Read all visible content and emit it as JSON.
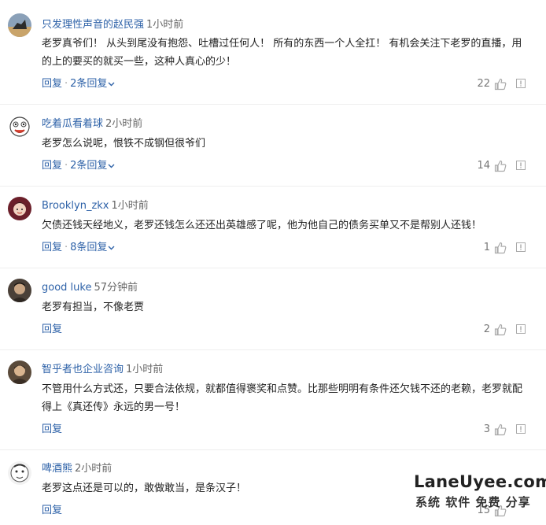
{
  "comments": [
    {
      "user": "只发理性声音的赵民强",
      "time": "1小时前",
      "text": "老罗真爷们！ 从头到尾没有抱怨、吐槽过任何人！ 所有的东西一个人全扛！ 有机会关注下老罗的直播，用的上的要买的就买一些，这种人真心的少！",
      "reply": "回复",
      "replies": "2条回复",
      "likes": "22"
    },
    {
      "user": "吃着瓜看着球",
      "time": "2小时前",
      "text": "老罗怎么说呢，恨铁不成钢但很爷们",
      "reply": "回复",
      "replies": "2条回复",
      "likes": "14"
    },
    {
      "user": "Brooklyn_zkx",
      "time": "1小时前",
      "text": "欠债还钱天经地义，老罗还钱怎么还还出英雄感了呢，他为他自己的债务买单又不是帮别人还钱！",
      "reply": "回复",
      "replies": "8条回复",
      "likes": "1"
    },
    {
      "user": "good luke",
      "time": "57分钟前",
      "text": "老罗有担当，不像老贾",
      "reply": "回复",
      "replies": "",
      "likes": "2"
    },
    {
      "user": "智乎者也企业咨询",
      "time": "1小时前",
      "text": "不管用什么方式还，只要合法依规，就都值得褒奖和点赞。比那些明明有条件还欠钱不还的老赖，老罗就配得上《真还传》永远的男一号！",
      "reply": "回复",
      "replies": "",
      "likes": "3"
    },
    {
      "user": "啤酒熊",
      "time": "2小时前",
      "text": "老罗这点还是可以的，敢做敢当，是条汉子！",
      "reply": "回复",
      "replies": "",
      "likes": "15"
    }
  ],
  "watermark": {
    "line1": "LaneUyee.com",
    "line2": "系统 软件 免费 分享"
  }
}
